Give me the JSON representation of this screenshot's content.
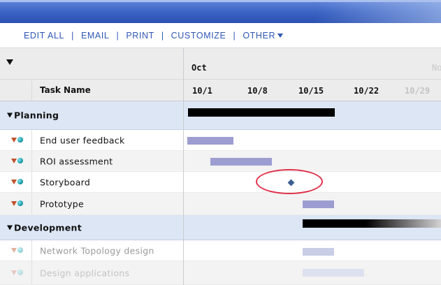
{
  "toolbar": {
    "items": [
      "EDIT ALL",
      "EMAIL",
      "PRINT",
      "CUSTOMIZE",
      "OTHER"
    ],
    "separator": "|"
  },
  "grid": {
    "column_header": "Task Name",
    "months": [
      "Oct",
      "No"
    ],
    "dates": [
      "10/1",
      "10/8",
      "10/15",
      "10/22",
      "10/29"
    ]
  },
  "rows": [
    {
      "type": "group",
      "label": "Planning"
    },
    {
      "type": "task",
      "label": "End user feedback"
    },
    {
      "type": "task",
      "label": "ROI assessment"
    },
    {
      "type": "task",
      "label": "Storyboard",
      "milestone": true
    },
    {
      "type": "task",
      "label": "Prototype"
    },
    {
      "type": "group",
      "label": "Development"
    },
    {
      "type": "task",
      "label": "Network Topology design"
    },
    {
      "type": "task",
      "label": "Design applications"
    }
  ],
  "colors": {
    "banner": "#3b64c4",
    "toolbar_link": "#2f57b5",
    "group_row": "#dce6f5",
    "task_bar": "#9d9dd2",
    "summary_bar": "#000000",
    "milestone": "#3d5f94",
    "highlight": "#e0314a",
    "status_triangle": "#c0532d",
    "status_dot": "#0d8f9d"
  }
}
